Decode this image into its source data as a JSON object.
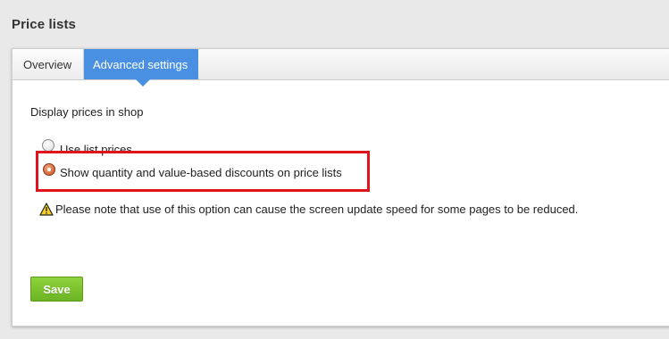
{
  "page": {
    "title": "Price lists"
  },
  "tabs": [
    {
      "label": "Overview",
      "active": false
    },
    {
      "label": "Advanced settings",
      "active": true
    }
  ],
  "section": {
    "label": "Display prices in shop"
  },
  "options": [
    {
      "label": "Use list prices",
      "selected": false
    },
    {
      "label": "Show quantity and value-based discounts on price lists",
      "selected": true
    }
  ],
  "note": {
    "icon": "warning-icon",
    "text": "Please note that use of this option can cause the screen update speed for some pages to be reduced."
  },
  "actions": {
    "save_label": "Save"
  },
  "colors": {
    "accent": "#4a90e2",
    "save": "#7cc22f",
    "highlight": "#e0141c",
    "radio_selected": "#d4602a"
  }
}
